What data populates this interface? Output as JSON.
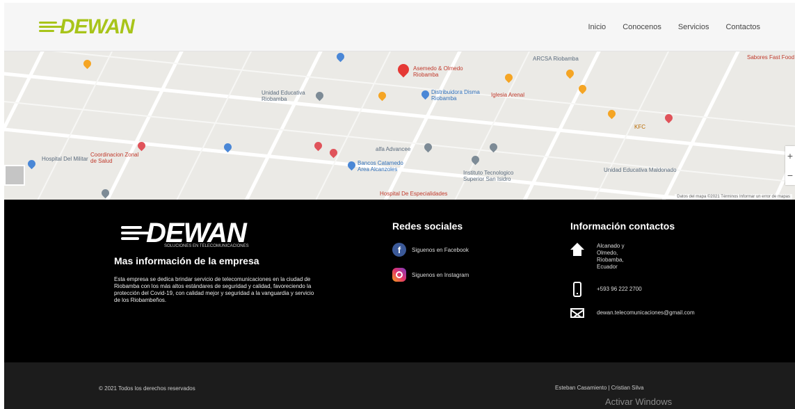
{
  "brand": {
    "name": "DEWAN",
    "tagline": "Mas informacion de la empresa"
  },
  "nav": {
    "items": [
      "Inicio",
      "Conocenos",
      "Servicios",
      "Contactos"
    ]
  },
  "map": {
    "places": [
      {
        "label": "Asemedo & Olmedo Riobamba",
        "kind": "red"
      },
      {
        "label": "Unidad Educativa Riobamba",
        "kind": "gray"
      },
      {
        "label": "Distribuidora Disma Riobamba",
        "kind": "blue"
      },
      {
        "label": "alfa Advancee",
        "kind": "gray"
      },
      {
        "label": "Bancos Catamedo Area Alcanzoles",
        "kind": "blue"
      },
      {
        "label": "Instituto Tecnologico Superior San Isidro",
        "kind": "gray"
      },
      {
        "label": "Hospital De Especialidades",
        "kind": "red"
      },
      {
        "label": "Coordinacion Zonal de Salud",
        "kind": "red"
      },
      {
        "label": "Hospital Del Militar",
        "kind": "gray"
      },
      {
        "label": "ARCSA Riobamba",
        "kind": "gray"
      },
      {
        "label": "KFC",
        "kind": "orange"
      },
      {
        "label": "Sabores Fast Food",
        "kind": "gray"
      },
      {
        "label": "Unidad Educativa Maldonado",
        "kind": "gray"
      },
      {
        "label": "Iglesia Arenal",
        "kind": "gray"
      }
    ],
    "zoom_in": "+",
    "zoom_out": "−",
    "footer_text": "Datos del mapa ©2021  Términos  Informar un error de mapas"
  },
  "footer": {
    "logo_sub": "SOLUCIONES EN TELECOMUNICACIONES",
    "about_title": "Mas información de la empresa",
    "about_text": "Esta empresa se dedica brindar servicio de telecomunicaciones en la ciudad de Riobamba con los más altos estándares de seguridad y calidad, favoreciendo la protección del Covid-19, con calidad mejor y seguridad a la vanguardia y servicio de los Riobambeños.",
    "social_title": "Redes sociales",
    "social": [
      {
        "label": "Siguenos en Facebook",
        "icon": "facebook-icon"
      },
      {
        "label": "Siguenos en Instagram",
        "icon": "instagram-icon"
      }
    ],
    "contact_title": "Información contactos",
    "contact": {
      "address": "Alcanado y Olmedo, Riobamba, Ecuador",
      "phone": "+593 96 222 2700",
      "email": "dewan.telecomunicaciones@gmail.com"
    }
  },
  "bottom": {
    "copyright": "© 2021 Todos los derechos reservados",
    "credits": "Esteban Casamiento | Cristian Silva",
    "activate": "Activar Windows"
  },
  "colors": {
    "brand_green": "#a8c41a",
    "footer_bg": "#000000",
    "bottom_bg": "#1c1c1c"
  }
}
